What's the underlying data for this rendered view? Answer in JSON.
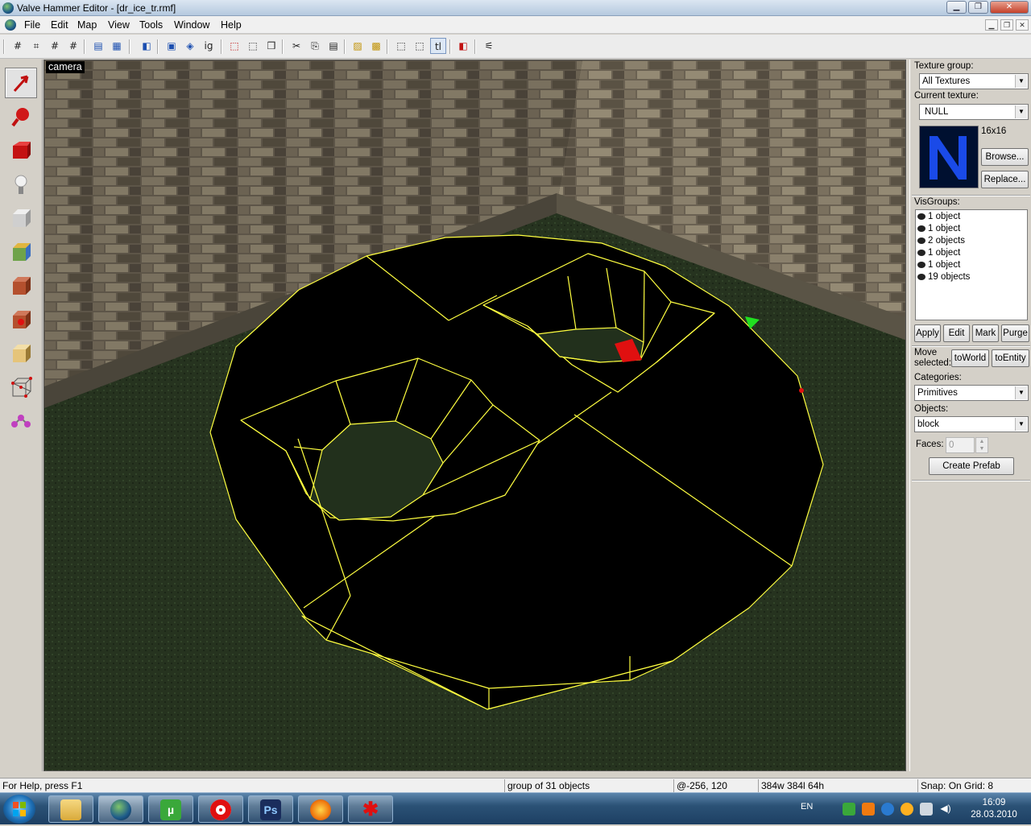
{
  "window": {
    "title": "Valve Hammer Editor - [dr_ice_tr.rmf]"
  },
  "menu": [
    "File",
    "Edit",
    "Map",
    "View",
    "Tools",
    "Window",
    "Help"
  ],
  "toolbar_icons": [
    "grid-toggle",
    "grid-3d",
    "grid-smaller",
    "grid-larger",
    "load-window-state",
    "group",
    "ungroup",
    "ignore-groups",
    "hide-selected",
    "show-all",
    "hide-unselected",
    "cut",
    "copy",
    "paste",
    "carve",
    "hollow",
    "texture-lock",
    "vertex-mode",
    "transparent-textures",
    "run-map",
    "compile"
  ],
  "left_tools": [
    "selection-tool",
    "magnify-tool",
    "camera-tool",
    "entity-tool",
    "block-tool",
    "texture-application-tool",
    "apply-current-texture",
    "decal-tool",
    "clipping-tool",
    "vertex-manipulation-tool",
    "path-tool"
  ],
  "viewport": {
    "label": "camera"
  },
  "panel": {
    "texture_group_label": "Texture group:",
    "texture_group_value": "All Textures",
    "current_texture_label": "Current texture:",
    "current_texture_value": "NULL",
    "texture_size": "16x16",
    "texture_preview_glyph": "N",
    "browse_label": "Browse...",
    "replace_label": "Replace...",
    "visgroups_label": "VisGroups:",
    "visgroups": [
      "1 object",
      "1 object",
      "2 objects",
      "1 object",
      "1 object",
      "19 objects"
    ],
    "apply_label": "Apply",
    "edit_label": "Edit",
    "mark_label": "Mark",
    "purge_label": "Purge",
    "move_selected_label": "Move selected:",
    "to_world_label": "toWorld",
    "to_entity_label": "toEntity",
    "categories_label": "Categories:",
    "categories_value": "Primitives",
    "objects_label": "Objects:",
    "objects_value": "block",
    "faces_label": "Faces:",
    "faces_value": "0",
    "create_prefab_label": "Create Prefab"
  },
  "status": {
    "help": "For Help, press F1",
    "selection": "group of 31 objects",
    "coords": "@-256, 120",
    "size": "384w 384l 64h",
    "snap": "Snap: On Grid: 8"
  },
  "taskbar": {
    "apps": [
      "explorer",
      "hammer",
      "utorrent",
      "opera",
      "photoshop",
      "firefox",
      "paint"
    ],
    "ps_glyph": "Ps",
    "ut_glyph": "µ",
    "lang": "EN",
    "time": "16:09",
    "date": "28.03.2010"
  },
  "colors": {
    "selection_wireframe": "#ffff40",
    "brush_face": "#000000",
    "floor": "#2a3a24",
    "wall": "#6d6453"
  }
}
